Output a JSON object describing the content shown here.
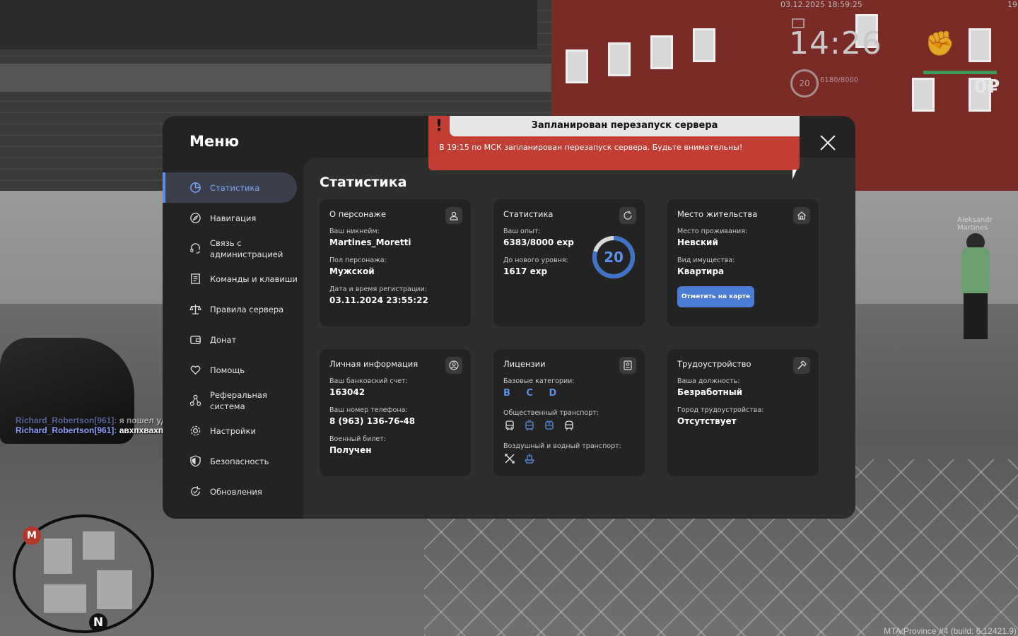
{
  "hud": {
    "datetime": "03.12.2025 18:59:25",
    "player_id": "19",
    "clock": "14:26",
    "level": "20",
    "exp": "6180/8000",
    "money": "0₽",
    "player_tag": "Aleksandr Martines",
    "build": "MTA:Province #4 (build: 6.12421.9)"
  },
  "chat": [
    {
      "name": "Richard_Robertson[961]:",
      "text": " я пошел удалять"
    },
    {
      "name": "Richard_Robertson[961]:",
      "text": " авхпхвахпав"
    }
  ],
  "minimap": {
    "metro": "М",
    "north": "N"
  },
  "menu": {
    "title": "Меню",
    "items": [
      {
        "label": "Статистика",
        "icon": "pie-chart-icon"
      },
      {
        "label": "Навигация",
        "icon": "compass-icon"
      },
      {
        "label": "Связь с администрацией",
        "icon": "headset-icon"
      },
      {
        "label": "Команды и клавиши",
        "icon": "document-icon"
      },
      {
        "label": "Правила сервера",
        "icon": "scales-icon"
      },
      {
        "label": "Донат",
        "icon": "wallet-icon"
      },
      {
        "label": "Помощь",
        "icon": "heart-hand-icon"
      },
      {
        "label": "Реферальная система",
        "icon": "referral-icon"
      },
      {
        "label": "Настройки",
        "icon": "gear-icon"
      },
      {
        "label": "Безопасность",
        "icon": "shield-icon"
      },
      {
        "label": "Обновления",
        "icon": "refresh-icon"
      }
    ],
    "active_index": 0
  },
  "stats": {
    "title": "Статистика",
    "character": {
      "title": "О персонаже",
      "nickname_label": "Ваш никнейм:",
      "nickname": "Martines_Moretti",
      "gender_label": "Пол персонажа:",
      "gender": "Мужской",
      "reg_label": "Дата и время регистрации:",
      "reg": "03.11.2024 23:55:22"
    },
    "statistics": {
      "title": "Статистика",
      "exp_label": "Ваш опыт:",
      "exp": "6383/8000 exp",
      "next_label": "До нового уровня:",
      "next": "1617 exp",
      "level": "20",
      "progress": 0.798
    },
    "residence": {
      "title": "Место жительства",
      "place_label": "Место проживания:",
      "place": "Невский",
      "type_label": "Вид имущества:",
      "type": "Квартира",
      "button": "Отметить на карте"
    },
    "personal": {
      "title": "Личная информация",
      "bank_label": "Ваш банковский счет:",
      "bank": "163042",
      "phone_label": "Ваш номер телефона:",
      "phone": "8 (963) 136-76-48",
      "military_label": "Военный билет:",
      "military": "Получен"
    },
    "licenses": {
      "title": "Лицензии",
      "base_label": "Базовые категории:",
      "base": "B C D",
      "public_label": "Общественный транспорт:",
      "air_label": "Воздушный и водный транспорт:"
    },
    "employment": {
      "title": "Трудоустройство",
      "position_label": "Ваша должность:",
      "position": "Безработный",
      "city_label": "Город трудоустройства:",
      "city": "Отсутствует"
    }
  },
  "notification": {
    "title": "Запланирован перезапуск сервера",
    "mark": "!",
    "text": "В 19:15 по МСК запланирован перезапуск сервера. Будьте внимательны!"
  },
  "colors": {
    "accent": "#5b8fe8",
    "alert": "#c23e35",
    "panel": "#232323",
    "content": "#2e2e2e"
  }
}
